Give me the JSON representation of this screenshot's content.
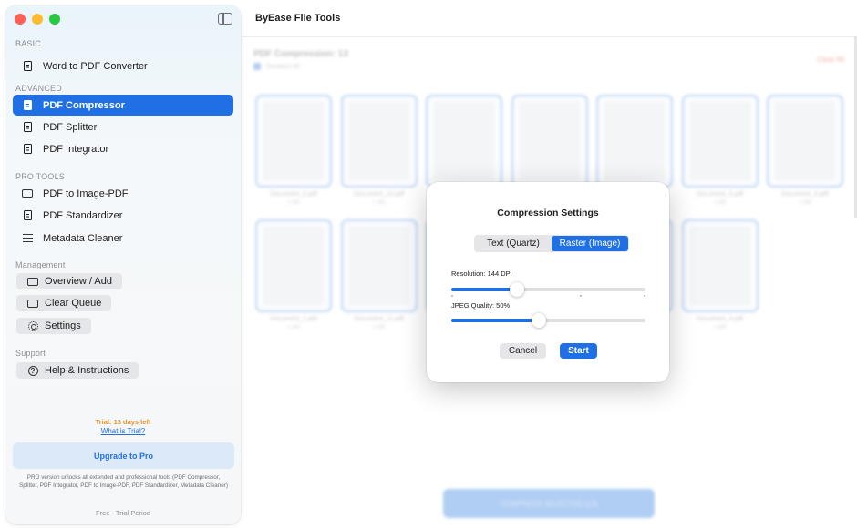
{
  "app": {
    "title": "ByEase File Tools"
  },
  "sidebar": {
    "sections": {
      "basic": "BASIC",
      "advanced": "ADVANCED",
      "pro_tools": "PRO TOOLS",
      "management": "Management",
      "support": "Support"
    },
    "items": {
      "word_to_pdf": "Word to PDF Converter",
      "pdf_compressor": "PDF Compressor",
      "pdf_splitter": "PDF Splitter",
      "pdf_integrator": "PDF Integrator",
      "pdf_to_image": "PDF to Image-PDF",
      "pdf_standardizer": "PDF Standardizer",
      "metadata_cleaner": "Metadata Cleaner"
    },
    "management": {
      "overview": "Overview / Add",
      "clear_queue": "Clear Queue",
      "settings": "Settings"
    },
    "support": {
      "help": "Help & Instructions"
    },
    "trial": {
      "days_left": "Trial: 13 days left",
      "what_is": "What is Trial?"
    },
    "upgrade_label": "Upgrade to Pro",
    "pro_description": "PRO version unlocks all extended and professional tools (PDF Compressor, Splitter, PDF Integrator, PDF to Image-PDF, PDF Standardizer, Metadata Cleaner)",
    "plan_label": "Free - Trial Period"
  },
  "queue": {
    "title": "PDF Compression: 13",
    "select_all": "Deselect All",
    "clear_all": "Clear All",
    "thumbnails": [
      {
        "name": "Document_0.pdf",
        "size": "1 MB"
      },
      {
        "name": "Document_10.pdf",
        "size": "1 MB"
      },
      {
        "name": "",
        "size": ""
      },
      {
        "name": "",
        "size": ""
      },
      {
        "name": "",
        "size": ""
      },
      {
        "name": "Document_5.pdf",
        "size": "1 MB"
      },
      {
        "name": "Document_6.pdf",
        "size": "1 MB"
      },
      {
        "name": "Document_1.pdf",
        "size": "1 MB"
      },
      {
        "name": "Document_11.pdf",
        "size": "1 MB"
      },
      {
        "name": "",
        "size": ""
      },
      {
        "name": "",
        "size": ""
      },
      {
        "name": "",
        "size": ""
      },
      {
        "name": "Document_4.pdf",
        "size": "1 MB"
      }
    ],
    "compress_button": "COMPRESS SELECTED (13)"
  },
  "dialog": {
    "title": "Compression Settings",
    "modes": [
      "Text (Quartz)",
      "Raster (Image)"
    ],
    "selected_mode": 1,
    "resolution": {
      "label": "Resolution: 144 DPI",
      "value": 144,
      "fraction": 0.34
    },
    "jpeg_quality": {
      "label": "JPEG Quality: 50%",
      "value": 50,
      "fraction": 0.45
    },
    "cancel": "Cancel",
    "start": "Start"
  },
  "colors": {
    "accent": "#1f6fe5",
    "trial": "#e8912d"
  }
}
